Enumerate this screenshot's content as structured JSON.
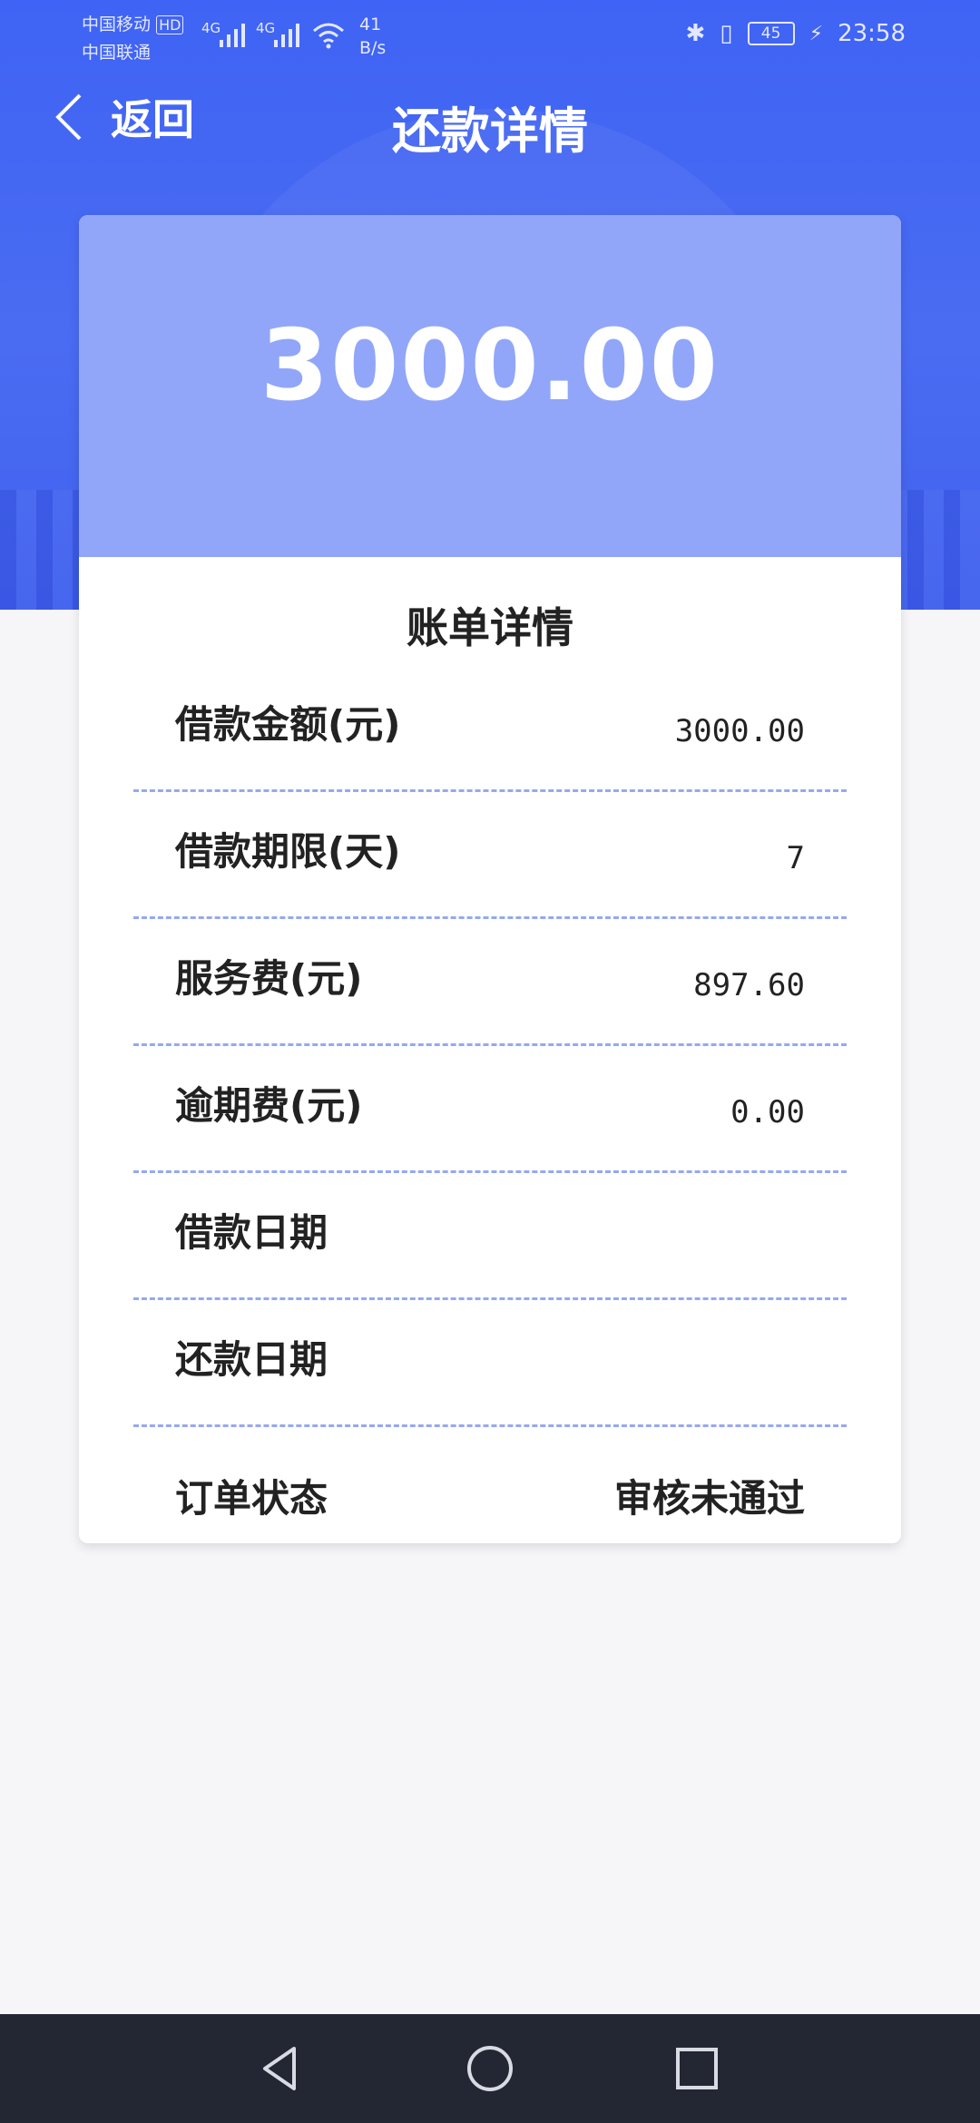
{
  "status_bar": {
    "carrier1": "中国移动",
    "carrier1_badge": "HD",
    "carrier2": "中国联通",
    "net1": "4G",
    "net2": "4G",
    "speed_value": "41",
    "speed_unit": "B/s",
    "battery": "45",
    "time": "23:58"
  },
  "header": {
    "back_label": "返回",
    "title": "还款详情"
  },
  "amount": "3000.00",
  "bill": {
    "section_title": "账单详情",
    "rows": [
      {
        "label": "借款金额(元)",
        "value": "3000.00"
      },
      {
        "label": "借款期限(天)",
        "value": "7"
      },
      {
        "label": "服务费(元)",
        "value": "897.60"
      },
      {
        "label": "逾期费(元)",
        "value": "0.00"
      },
      {
        "label": "借款日期",
        "value": ""
      },
      {
        "label": "还款日期",
        "value": ""
      },
      {
        "label": "订单状态",
        "value": "审核未通过"
      }
    ]
  },
  "colors": {
    "accent": "#4a6cf2",
    "amount_box": "#91a6f9",
    "divider": "#95a9f0"
  },
  "icons": {
    "back": "chevron-left-icon",
    "nav_back": "triangle-back-icon",
    "nav_home": "circle-home-icon",
    "nav_recent": "square-recent-icon"
  }
}
